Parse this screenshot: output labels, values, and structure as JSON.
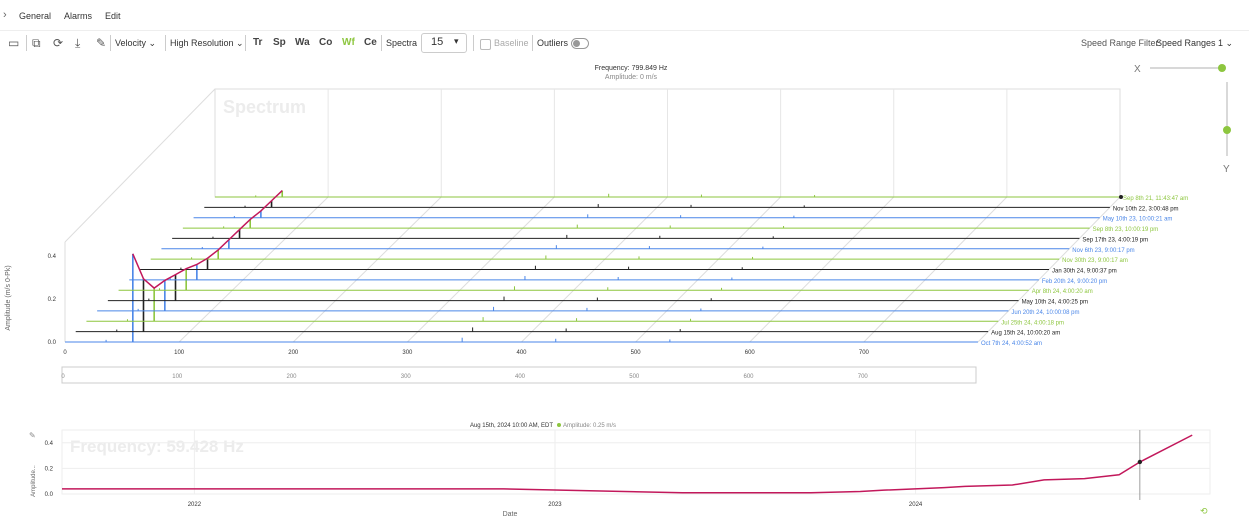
{
  "menu": {
    "expand_icon": "chevron-right-icon",
    "items": [
      "General",
      "Alarms",
      "Edit"
    ]
  },
  "toolbar": {
    "icons": [
      "panel-icon",
      "camera-settings-icon",
      "refresh-icon",
      "download-icon",
      "pencil-icon"
    ],
    "measure": "Velocity ⌄",
    "resolution": "High Resolution ⌄",
    "modes": [
      {
        "label": "Tr",
        "color": "#444444"
      },
      {
        "label": "Sp",
        "color": "#444444"
      },
      {
        "label": "Wa",
        "color": "#444444"
      },
      {
        "label": "Co",
        "color": "#444444"
      },
      {
        "label": "Wf",
        "color": "#8dc63f"
      },
      {
        "label": "Ce",
        "color": "#444444"
      }
    ],
    "spectra_label": "Spectra",
    "spectra_value": "15",
    "spectra_caret": "▾",
    "baseline_label": "Baseline",
    "outliers_label": "Outliers",
    "speed_filter_label": "Speed Range Filter:",
    "speed_filter_value": "Speed Ranges 1 ⌄"
  },
  "chart_data": [
    {
      "type": "line",
      "subtype": "waterfall-3d",
      "title": "Frequency: 799.849 Hz",
      "subtitle": "Amplitude: 0 m/s",
      "watermark": "Spectrum",
      "ylabel": "Amplitude (m/s 0-Pk)",
      "xlim": [
        0,
        800
      ],
      "x_ticks": [
        0,
        100,
        200,
        300,
        400,
        500,
        600,
        700
      ],
      "ylim": [
        0,
        0.5
      ],
      "y_ticks": [
        "0.0",
        "0.2",
        "0.4"
      ],
      "axis_controls": {
        "x": "X",
        "y": "Y"
      },
      "colors": {
        "blue": "#4a86e8",
        "green": "#8dc63f",
        "black": "#222222",
        "cursor": "#c2185b"
      },
      "series": [
        {
          "name": "Oct 7th 24, 4:00:52 am",
          "color": "blue",
          "peak": 0.41
        },
        {
          "name": "Aug 15th 24, 10:00:20 am",
          "color": "black",
          "peak": 0.25
        },
        {
          "name": "Jul 25th 24, 4:00:18 pm",
          "color": "green",
          "peak": 0.16
        },
        {
          "name": "Jun 20th 24, 10:00:08 pm",
          "color": "blue",
          "peak": 0.15
        },
        {
          "name": "May 10th 24, 4:00:25 pm",
          "color": "black",
          "peak": 0.13
        },
        {
          "name": "Apr 8th 24, 4:00:20 am",
          "color": "green",
          "peak": 0.11
        },
        {
          "name": "Feb 20th 24, 9:00:20 pm",
          "color": "blue",
          "peak": 0.08
        },
        {
          "name": "Jan 30th 24, 9:00:37 pm",
          "color": "black",
          "peak": 0.06
        },
        {
          "name": "Nov 30th 23, 9:00:17 am",
          "color": "green",
          "peak": 0.05
        },
        {
          "name": "Nov 6th 23, 9:00:17 pm",
          "color": "blue",
          "peak": 0.05
        },
        {
          "name": "Sep 17th 23, 4:00:19 pm",
          "color": "black",
          "peak": 0.05
        },
        {
          "name": "Sep 8th 23, 10:00:19 pm",
          "color": "green",
          "peak": 0.05
        },
        {
          "name": "May 10th 23, 10:00:21 am",
          "color": "blue",
          "peak": 0.04
        },
        {
          "name": "Nov 10th 22, 3:00:48 pm",
          "color": "black",
          "peak": 0.04
        },
        {
          "name": "Sep 8th 21, 11:43:47 am",
          "color": "green",
          "peak": 0.04
        }
      ],
      "peak_frequency": 59.428
    },
    {
      "type": "line",
      "title": "Aug 15th, 2024 10:00 AM, EDT",
      "legend": "Amplitude: 0.25 m/s",
      "watermark": "Frequency: 59.428 Hz",
      "ylabel": "Amplitude...",
      "xlabel": "Date",
      "ylim": [
        0,
        0.5
      ],
      "y_ticks": [
        "0.0",
        "0.2",
        "0.4"
      ],
      "x_ticks": [
        "2022",
        "2023",
        "2024"
      ],
      "x": [
        "2021-09-08",
        "2022-11-10",
        "2023-05-10",
        "2023-09-08",
        "2023-09-17",
        "2023-11-06",
        "2023-11-30",
        "2024-01-30",
        "2024-02-20",
        "2024-04-08",
        "2024-05-10",
        "2024-06-20",
        "2024-07-25",
        "2024-08-15",
        "2024-10-07"
      ],
      "y": [
        0.04,
        0.04,
        0.01,
        0.01,
        0.01,
        0.02,
        0.03,
        0.05,
        0.06,
        0.07,
        0.11,
        0.12,
        0.15,
        0.25,
        0.46
      ],
      "selected": "2024-08-15",
      "line_color": "#c2185b"
    }
  ]
}
